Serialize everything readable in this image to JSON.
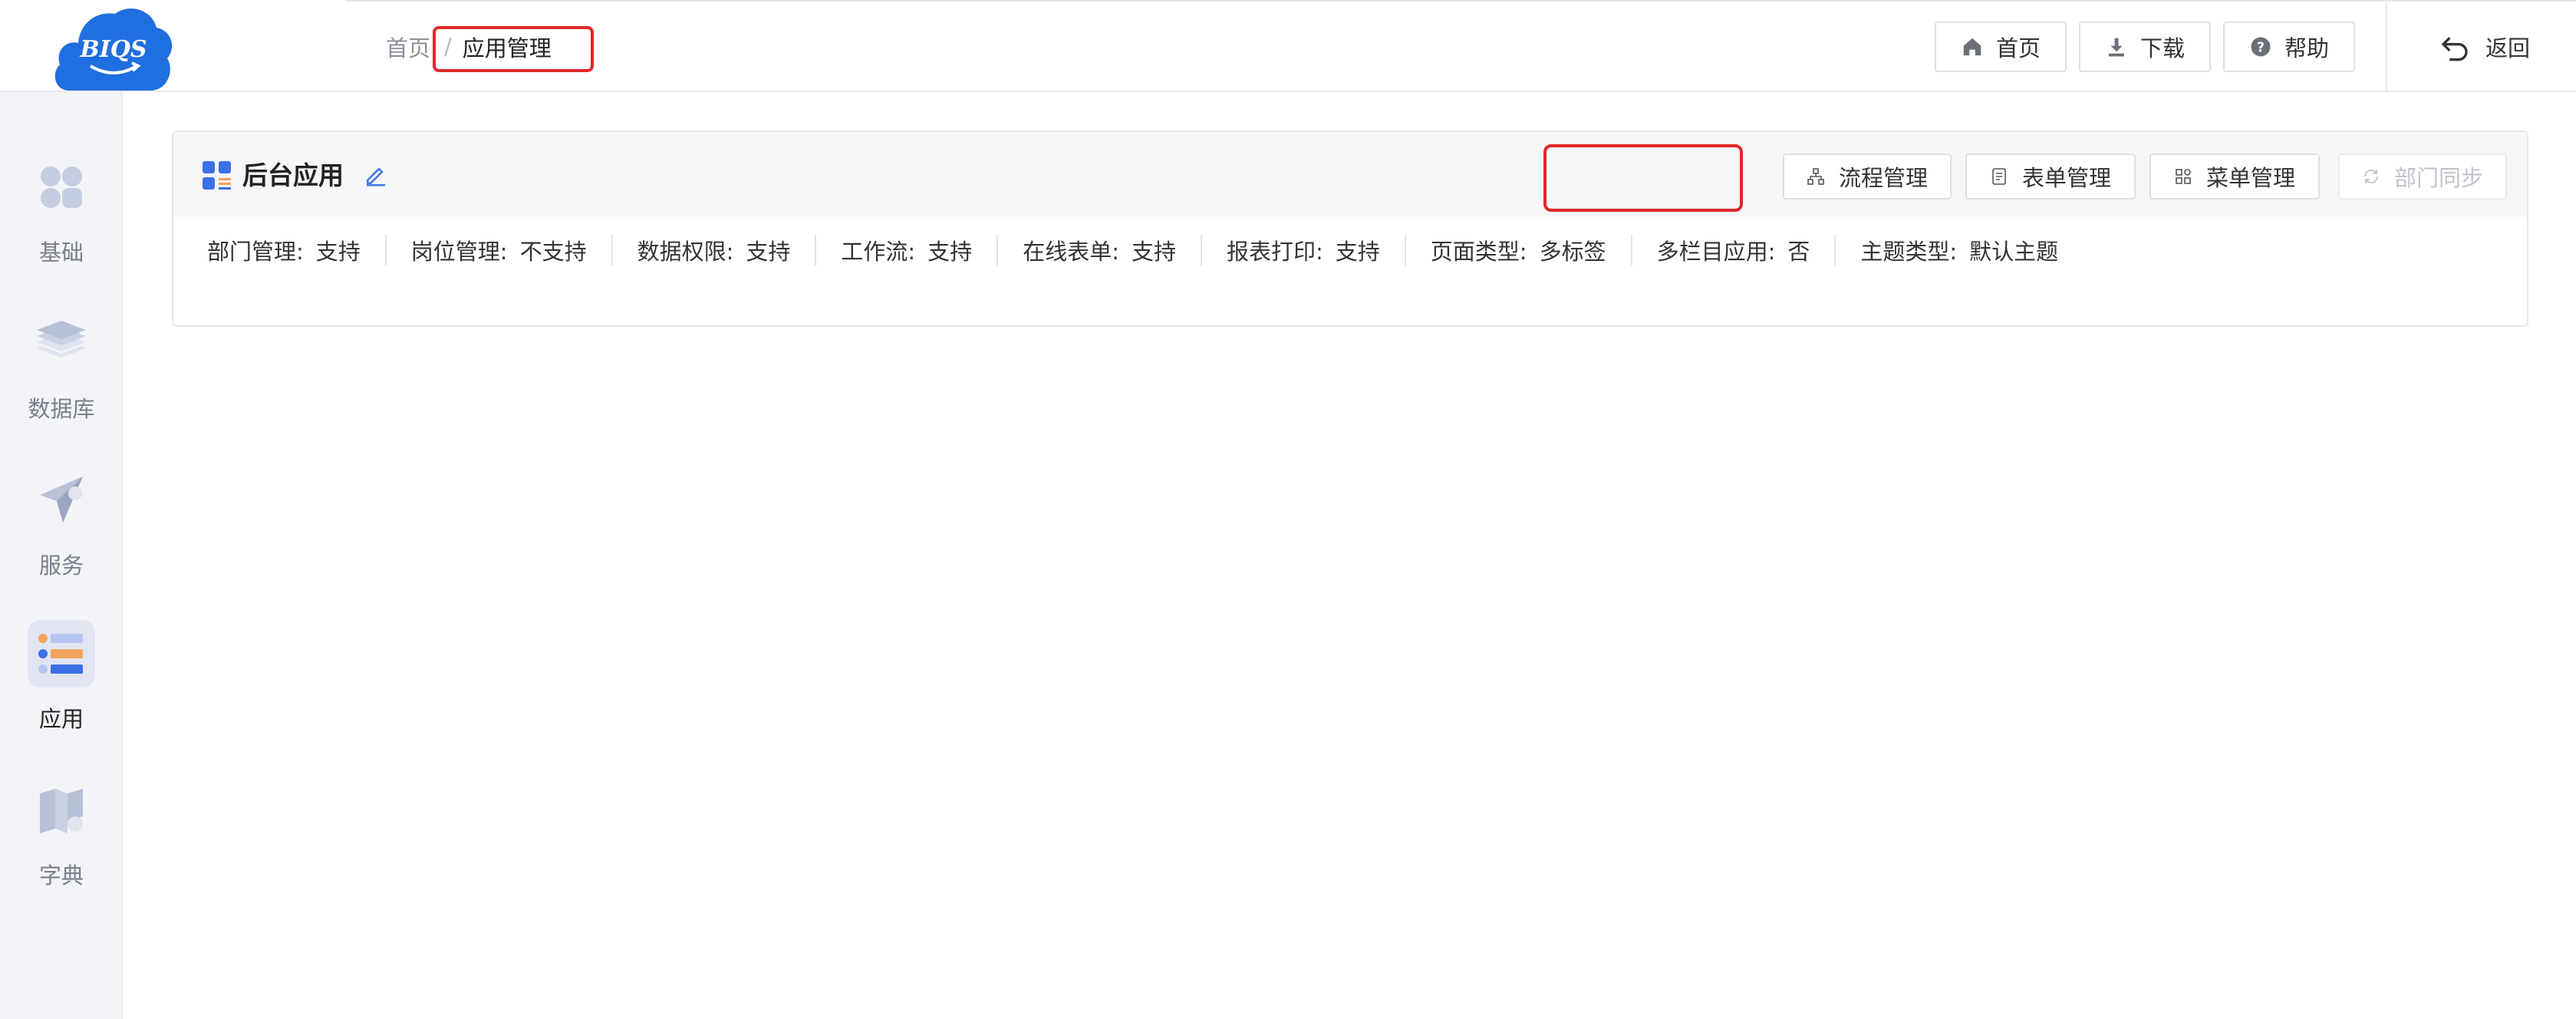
{
  "header": {
    "breadcrumb": {
      "home": "首页",
      "separator": "/",
      "current": "应用管理"
    },
    "buttons": {
      "home": "首页",
      "download": "下载",
      "help": "帮助"
    },
    "back": "返回",
    "logo_text": "BIQS"
  },
  "sidebar": {
    "items": [
      {
        "label": "基础",
        "icon": "apps-dots-icon",
        "active": false
      },
      {
        "label": "数据库",
        "icon": "layers-icon",
        "active": false
      },
      {
        "label": "服务",
        "icon": "send-icon",
        "active": false
      },
      {
        "label": "应用",
        "icon": "list-app-icon",
        "active": true
      },
      {
        "label": "字典",
        "icon": "book-icon",
        "active": false
      }
    ]
  },
  "app": {
    "title": "后台应用",
    "actions": {
      "flow": "流程管理",
      "form": "表单管理",
      "menu": "菜单管理",
      "dept_sync": "部门同步"
    },
    "props": [
      {
        "label": "部门管理:",
        "value": "支持"
      },
      {
        "label": "岗位管理:",
        "value": "不支持"
      },
      {
        "label": "数据权限:",
        "value": "支持"
      },
      {
        "label": "工作流:",
        "value": "支持"
      },
      {
        "label": "在线表单:",
        "value": "支持"
      },
      {
        "label": "报表打印:",
        "value": "支持"
      },
      {
        "label": "页面类型:",
        "value": "多标签"
      },
      {
        "label": "多栏目应用:",
        "value": "否"
      },
      {
        "label": "主题类型:",
        "value": "默认主题"
      }
    ]
  },
  "colors": {
    "highlight": "#e0282a",
    "brand_blue": "#1f6fe0",
    "accent_blue": "#3d6fe6",
    "accent_orange": "#f3a35b"
  }
}
